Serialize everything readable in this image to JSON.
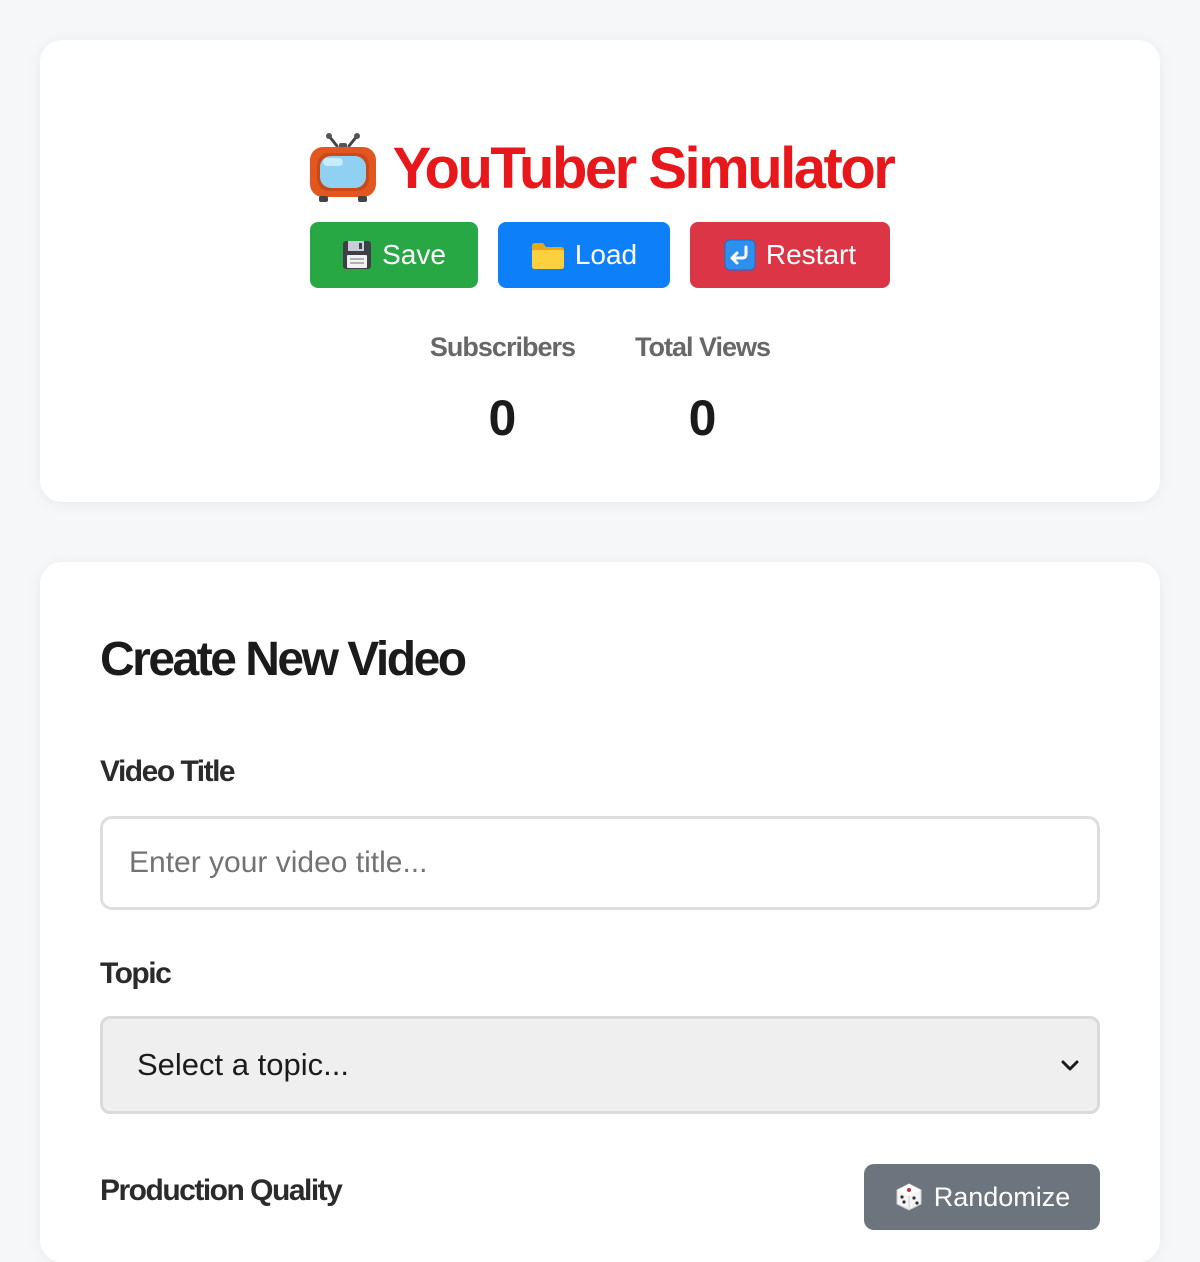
{
  "header": {
    "title": "YouTuber Simulator",
    "title_icon": "television-icon",
    "title_color": "#e8171c"
  },
  "actions": {
    "save": {
      "label": "Save",
      "icon": "floppy-disk-icon",
      "color": "#28a745"
    },
    "load": {
      "label": "Load",
      "icon": "folder-icon",
      "color": "#0d7ff9"
    },
    "restart": {
      "label": "Restart",
      "icon": "return-arrow-icon",
      "color": "#dc3545"
    }
  },
  "stats": {
    "subscribers": {
      "label": "Subscribers",
      "value": "0"
    },
    "total_views": {
      "label": "Total Views",
      "value": "0"
    }
  },
  "create_video": {
    "heading": "Create New Video",
    "title_field": {
      "label": "Video Title",
      "placeholder": "Enter your video title...",
      "value": ""
    },
    "topic_field": {
      "label": "Topic",
      "selected": "Select a topic..."
    },
    "quality_field": {
      "label": "Production Quality"
    },
    "randomize": {
      "label": "Randomize",
      "icon": "dice-icon",
      "color": "#6c757d"
    }
  }
}
